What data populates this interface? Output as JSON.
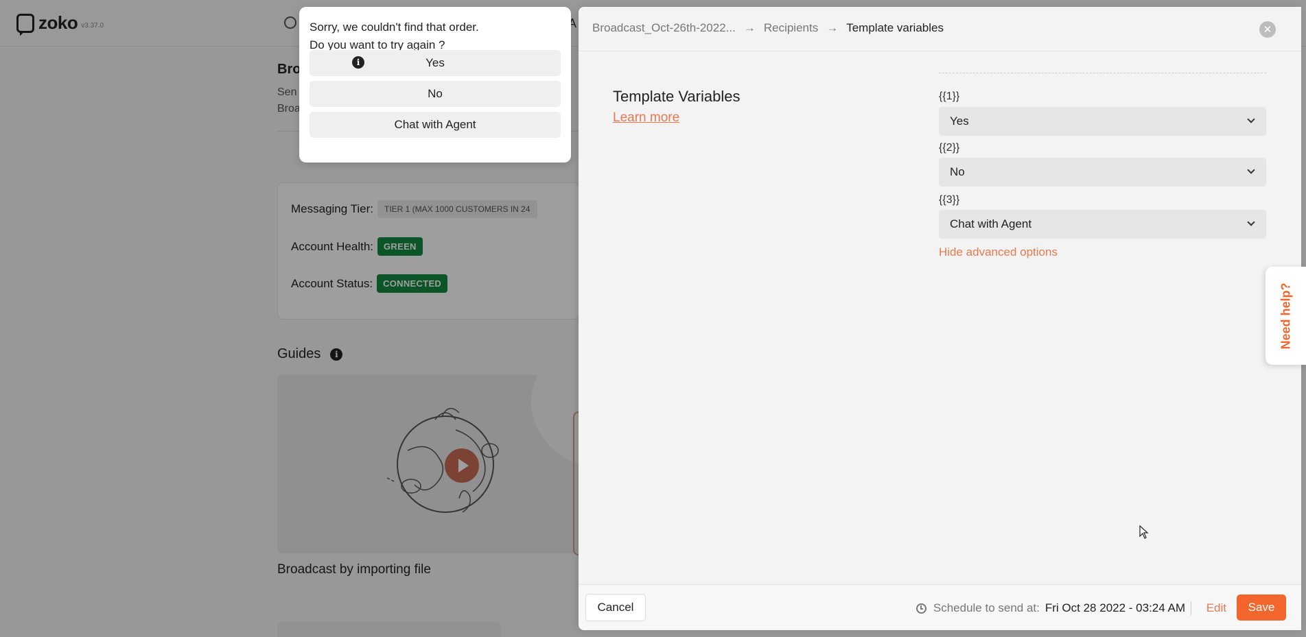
{
  "app": {
    "logo_text": "zoko",
    "version": "v3.37.0",
    "topbar_letter": "A"
  },
  "background": {
    "title": "Bro",
    "subtitle_line1": "Sen",
    "subtitle_line2": "Broa",
    "tier": {
      "messaging_tier_label": "Messaging Tier:",
      "messaging_tier_value": "TIER 1 (MAX 1000 CUSTOMERS IN 24",
      "account_health_label": "Account Health:",
      "account_health_value": "GREEN",
      "account_status_label": "Account Status:",
      "account_status_value": "CONNECTED"
    },
    "guides_title": "Guides",
    "guide_caption": "Broadcast by importing file"
  },
  "chat_popup": {
    "message_line1": "Sorry, we couldn't find that order.",
    "message_line2": "Do you want to try again ?",
    "buttons": [
      "Yes",
      "No",
      "Chat with Agent"
    ]
  },
  "panel": {
    "breadcrumbs": [
      "Broadcast_Oct-26th-2022...",
      "Recipients",
      "Template variables"
    ],
    "section_title": "Template Variables",
    "learn_more": "Learn more",
    "variables": [
      {
        "label": "{{1}}",
        "value": "Yes"
      },
      {
        "label": "{{2}}",
        "value": "No"
      },
      {
        "label": "{{3}}",
        "value": "Chat with Agent"
      }
    ],
    "hide_advanced": "Hide advanced options",
    "footer": {
      "cancel": "Cancel",
      "schedule_label": "Schedule to send at:",
      "schedule_value": "Fri Oct 28 2022 - 03:24 AM",
      "edit": "Edit",
      "save": "Save"
    }
  },
  "need_help": "Need help?",
  "colors": {
    "accent": "#f2662d",
    "link": "#e8794f",
    "status_green": "#138a43"
  }
}
